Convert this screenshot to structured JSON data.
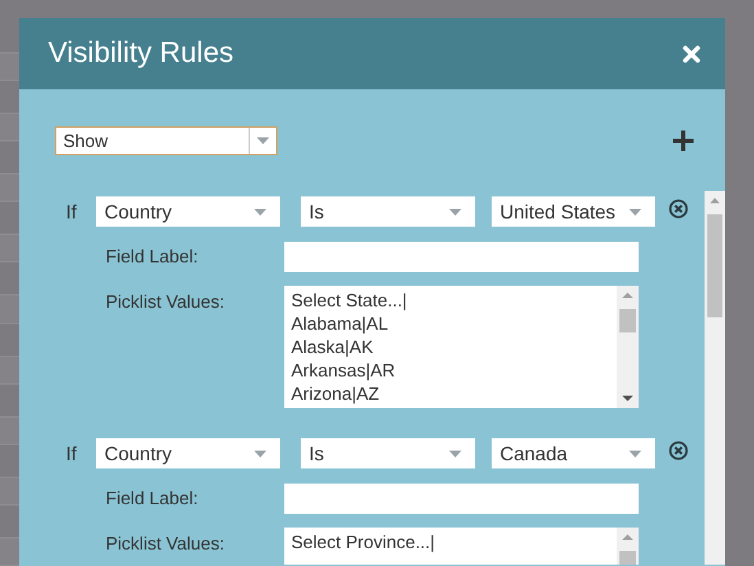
{
  "dialog": {
    "title": "Visibility Rules",
    "action": {
      "value": "Show"
    },
    "rules": [
      {
        "prefix": "If",
        "field": "Country",
        "operator": "Is",
        "value": "United States",
        "field_label": {
          "label": "Field Label:"
        },
        "picklist": {
          "label": "Picklist Values:",
          "lines": [
            "Select State...|",
            "Alabama|AL",
            "Alaska|AK",
            "Arkansas|AR",
            "Arizona|AZ"
          ]
        }
      },
      {
        "prefix": "If",
        "field": "Country",
        "operator": "Is",
        "value": "Canada",
        "field_label": {
          "label": "Field Label:"
        },
        "picklist": {
          "label": "Picklist Values:",
          "lines": [
            "Select Province...|"
          ]
        }
      }
    ]
  }
}
